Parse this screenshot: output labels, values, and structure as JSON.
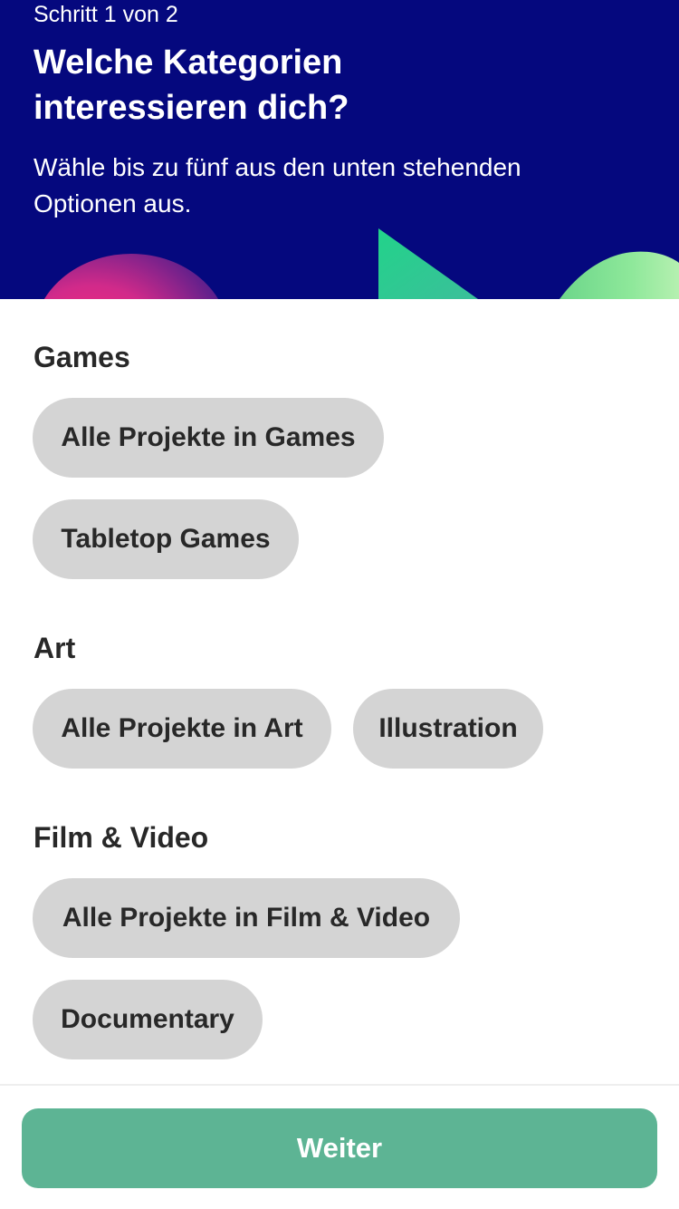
{
  "header": {
    "step": "Schritt 1 von 2",
    "title": "Welche Kategorien interessieren dich?",
    "subtitle": "Wähle bis zu fünf aus den unten stehenden Optionen aus.",
    "background_color": "#05087e"
  },
  "sections": [
    {
      "title": "Games",
      "options": [
        "Alle Projekte in Games",
        "Tabletop Games"
      ]
    },
    {
      "title": "Art",
      "options": [
        "Alle Projekte in Art",
        "Illustration"
      ]
    },
    {
      "title": "Film & Video",
      "options": [
        "Alle Projekte in Film & Video",
        "Documentary"
      ]
    }
  ],
  "footer": {
    "next_label": "Weiter",
    "button_color": "#5db494"
  },
  "colors": {
    "chip_background": "#d4d4d4",
    "text": "#282828"
  }
}
